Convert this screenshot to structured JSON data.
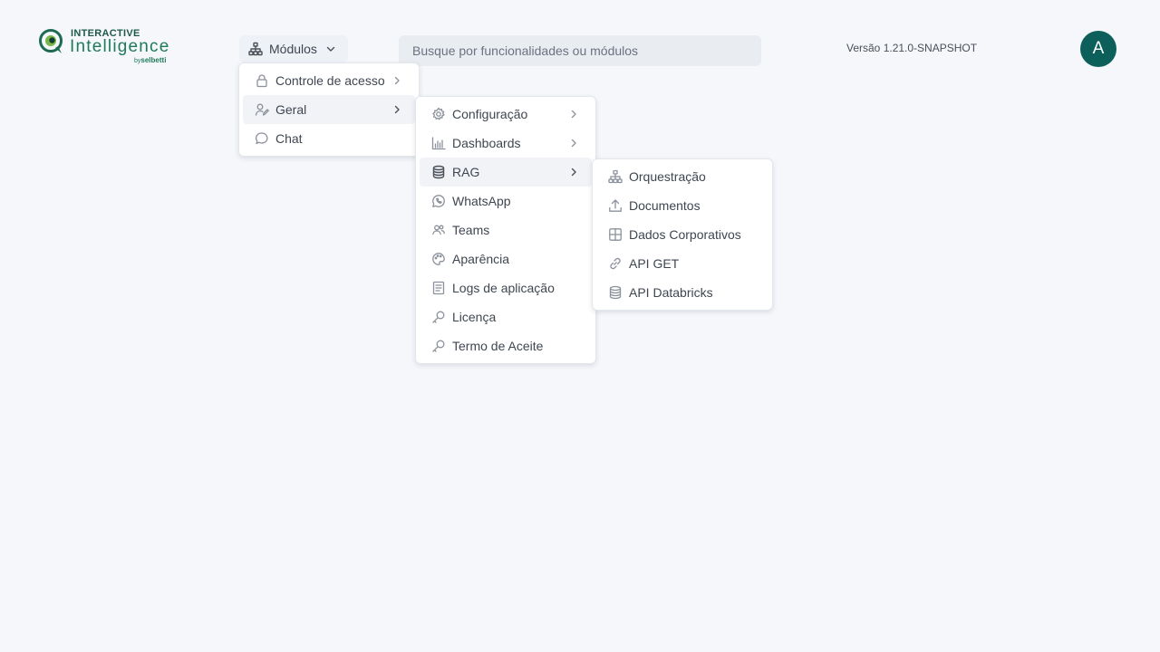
{
  "brand": {
    "line1": "INTERACTIVE",
    "line2": "Intelligence",
    "by": "by",
    "company": "selbetti",
    "color": "#1f7a57"
  },
  "header": {
    "modules_label": "Módulos",
    "search_placeholder": "Busque por funcionalidades ou módulos",
    "search_value": "",
    "version": "Versão 1.21.0-SNAPSHOT",
    "avatar_initial": "A",
    "avatar_color": "#0c5f5b"
  },
  "menu_level1": [
    {
      "label": "Controle de acesso",
      "icon": "lock-icon",
      "has_submenu": true
    },
    {
      "label": "Geral",
      "icon": "user-edit-icon",
      "has_submenu": true,
      "active": true
    },
    {
      "label": "Chat",
      "icon": "chat-bubble-icon",
      "has_submenu": false
    }
  ],
  "menu_level2": [
    {
      "label": "Configuração",
      "icon": "gear-icon",
      "has_submenu": true
    },
    {
      "label": "Dashboards",
      "icon": "bar-chart-icon",
      "has_submenu": true
    },
    {
      "label": "RAG",
      "icon": "database-icon",
      "has_submenu": true,
      "active": true
    },
    {
      "label": "WhatsApp",
      "icon": "whatsapp-icon",
      "has_submenu": false
    },
    {
      "label": "Teams",
      "icon": "users-icon",
      "has_submenu": false
    },
    {
      "label": "Aparência",
      "icon": "palette-icon",
      "has_submenu": false
    },
    {
      "label": "Logs de aplicação",
      "icon": "log-list-icon",
      "has_submenu": false
    },
    {
      "label": "Licença",
      "icon": "key-icon",
      "has_submenu": false
    },
    {
      "label": "Termo de Aceite",
      "icon": "key-icon",
      "has_submenu": false
    }
  ],
  "menu_level3": [
    {
      "label": "Orquestração",
      "icon": "sitemap-icon"
    },
    {
      "label": "Documentos",
      "icon": "upload-icon"
    },
    {
      "label": "Dados Corporativos",
      "icon": "table-grid-icon"
    },
    {
      "label": "API GET",
      "icon": "link-icon"
    },
    {
      "label": "API Databricks",
      "icon": "database-icon"
    }
  ]
}
